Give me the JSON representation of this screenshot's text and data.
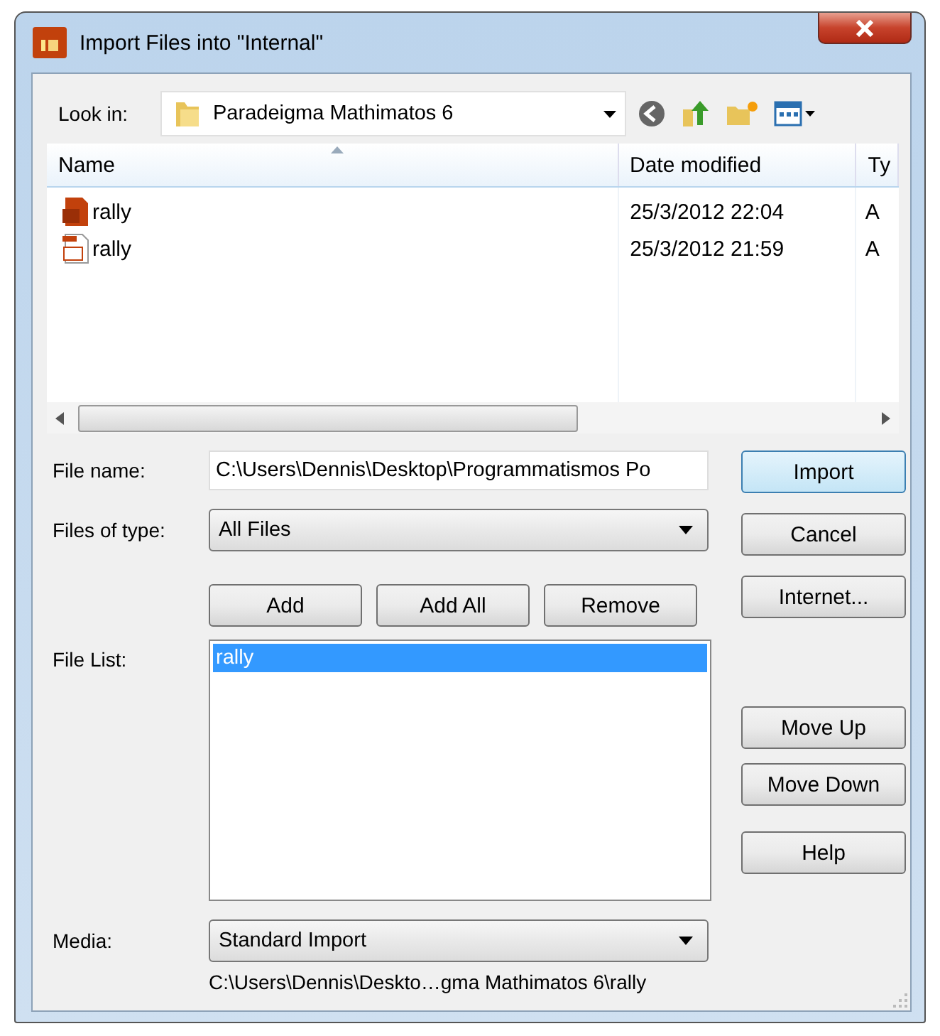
{
  "window": {
    "title": "Import Files into \"Internal\""
  },
  "look_in": {
    "label": "Look in:",
    "value": "Paradeigma Mathimatos 6"
  },
  "file_view": {
    "columns": [
      "Name",
      "Date modified",
      "Ty"
    ],
    "rows": [
      {
        "name": "rally",
        "date": "25/3/2012 22:04",
        "type": "A",
        "kind": "solid"
      },
      {
        "name": "rally",
        "date": "25/3/2012 21:59",
        "type": "A",
        "kind": "outline"
      }
    ]
  },
  "file_name": {
    "label": "File name:",
    "value": "C:\\Users\\Dennis\\Desktop\\Programmatismos Po"
  },
  "files_of_type": {
    "label": "Files of type:",
    "value": "All Files"
  },
  "list_buttons": [
    "Add",
    "Add All",
    "Remove"
  ],
  "file_list": {
    "label": "File List:",
    "items": [
      {
        "label": "rally",
        "selected": true
      }
    ]
  },
  "side_button_groups": [
    {
      "buttons": [
        {
          "label": "Import",
          "default": true
        },
        {
          "label": "Cancel",
          "default": false
        },
        {
          "label": "Internet...",
          "default": false
        }
      ]
    },
    {
      "buttons": [
        {
          "label": "Move Up",
          "default": false
        },
        {
          "label": "Move Down",
          "default": false
        }
      ]
    },
    {
      "buttons": [
        {
          "label": "Help",
          "default": false
        }
      ]
    }
  ],
  "media": {
    "label": "Media:",
    "value": "Standard Import"
  },
  "path": "C:\\Users\\Dennis\\Deskto…gma Mathimatos 6\\rally"
}
